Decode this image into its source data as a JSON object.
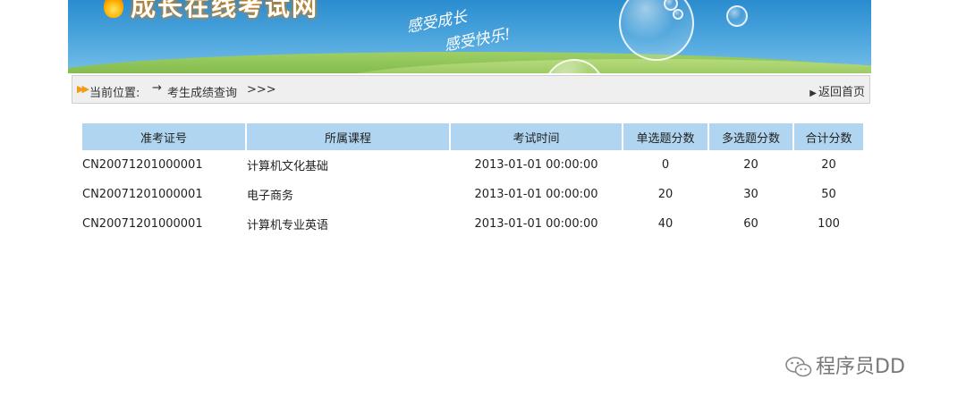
{
  "banner": {
    "logo_text": "成长在线考试网",
    "slogan_line1": "感受成长",
    "slogan_line2": "感受快乐!"
  },
  "breadcrumb": {
    "label": "当前位置:",
    "separator": "→",
    "current_page": "考生成绩查询",
    "trail": ">>>",
    "back_link": "返回首页"
  },
  "table": {
    "headers": [
      "准考证号",
      "所属课程",
      "考试时间",
      "单选题分数",
      "多选题分数",
      "合计分数"
    ],
    "rows": [
      [
        "CN20071201000001",
        "计算机文化基础",
        "2013-01-01 00:00:00",
        "0",
        "20",
        "20"
      ],
      [
        "CN20071201000001",
        "电子商务",
        "2013-01-01 00:00:00",
        "20",
        "30",
        "50"
      ],
      [
        "CN20071201000001",
        "计算机专业英语",
        "2013-01-01 00:00:00",
        "40",
        "60",
        "100"
      ]
    ]
  },
  "watermark": {
    "text": "程序员DD",
    "icon": "wechat-icon"
  },
  "colors": {
    "header_bg": "#afd5f0",
    "breadcrumb_bg": "#efefef",
    "accent_arrow": "#f39a16"
  }
}
